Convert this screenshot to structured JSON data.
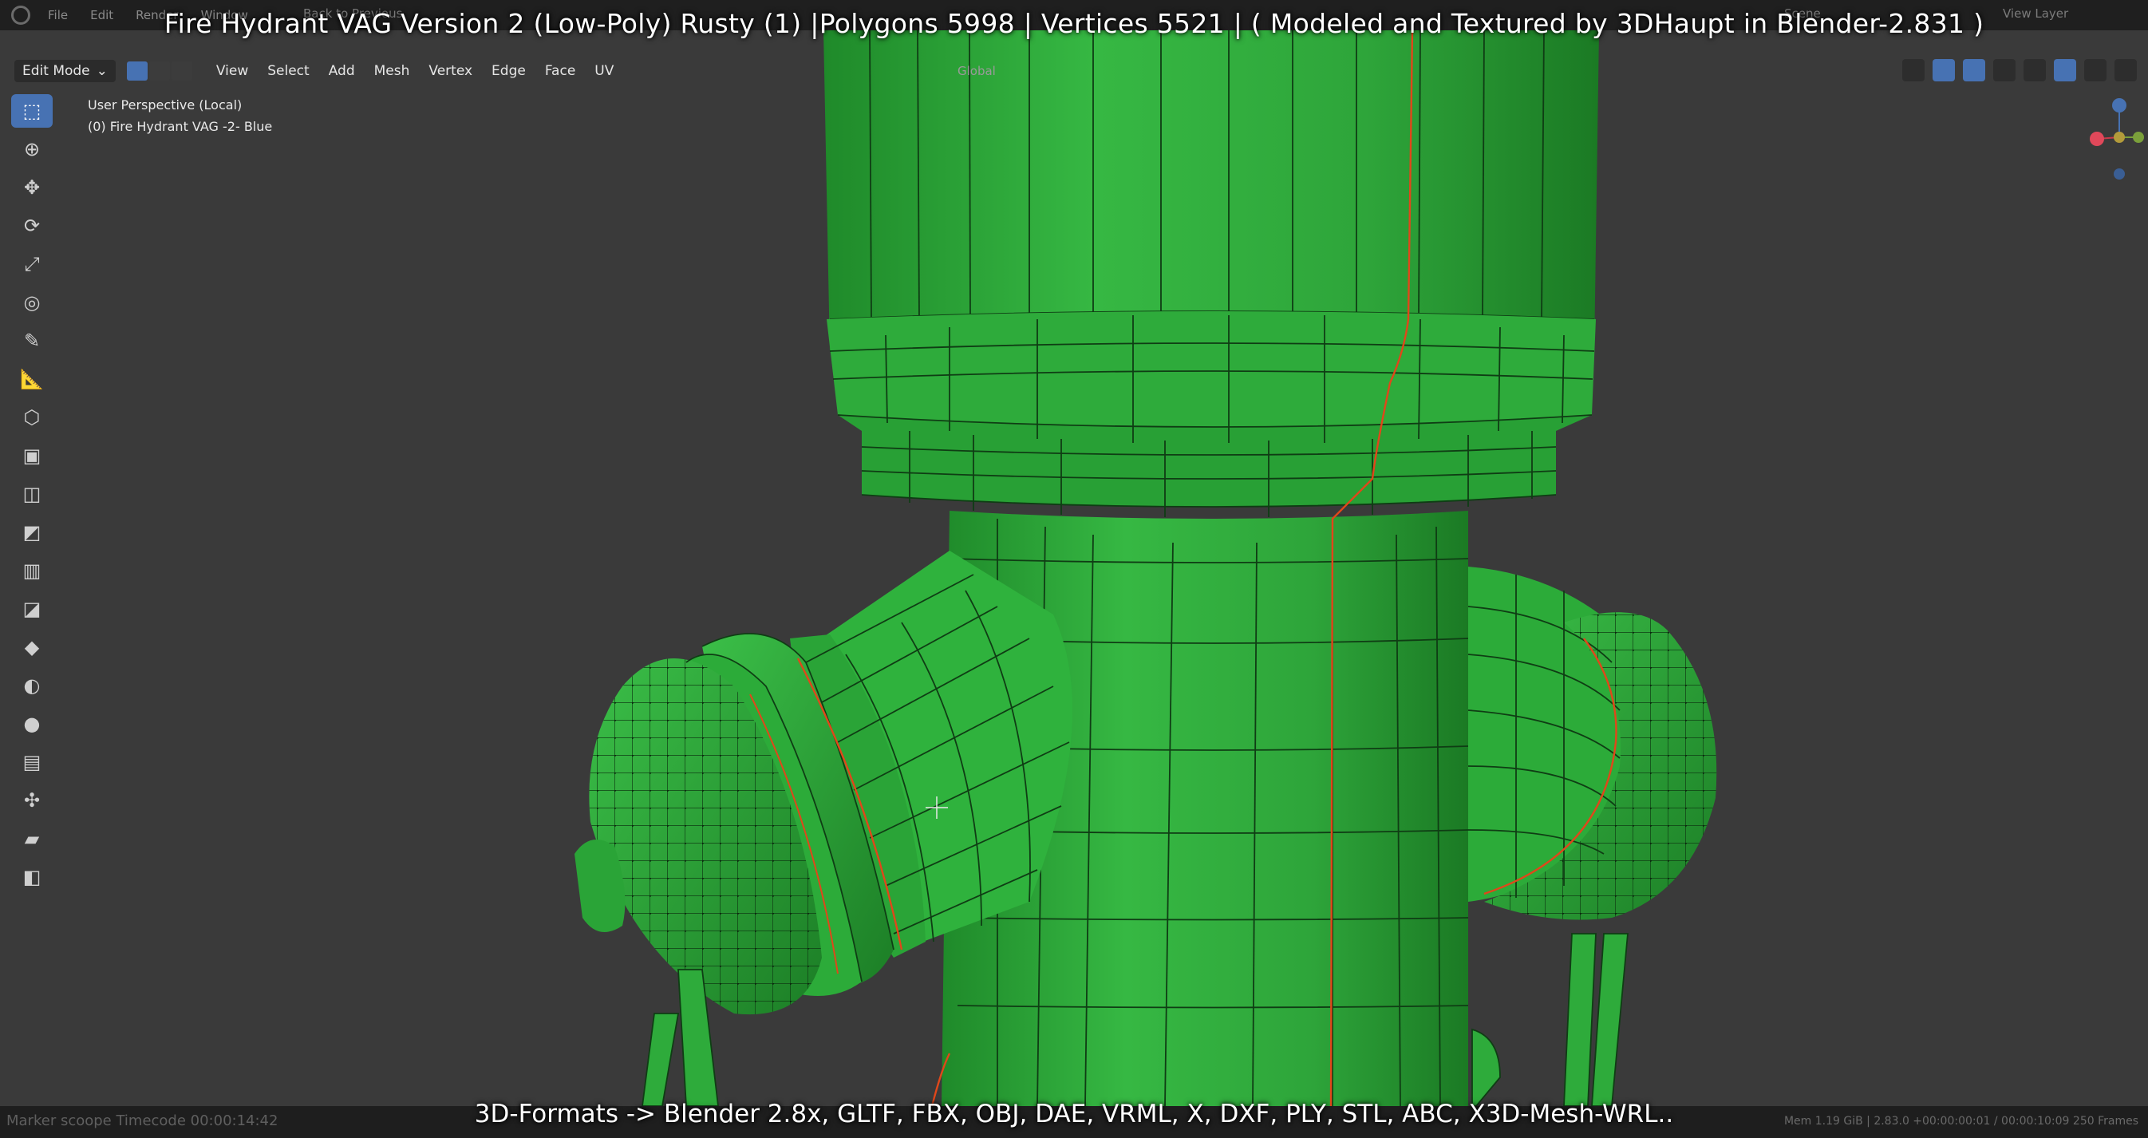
{
  "topbar": {
    "menus": [
      "File",
      "Edit",
      "Render",
      "Window"
    ],
    "workspace": "Back to Previous",
    "scene": "Scene",
    "view_layer": "View Layer"
  },
  "overlay": {
    "title": "Fire Hydrant VAG Version 2 (Low-Poly) Rusty (1) |Polygons 5998 | Vertices 5521 | ( Modeled and Textured by 3DHaupt in Blender-2.831 )",
    "formats": "3D-Formats -> Blender 2.8x, GLTF, FBX, OBJ, DAE, VRML, X, DXF, PLY, STL, ABC, X3D-Mesh-WRL.."
  },
  "header": {
    "mode": "Edit Mode",
    "menus": [
      "View",
      "Select",
      "Add",
      "Mesh",
      "Vertex",
      "Edge",
      "Face",
      "UV"
    ],
    "orientation": "Global"
  },
  "viewport": {
    "perspective": "User Perspective (Local)",
    "object": "(0) Fire Hydrant VAG -2- Blue"
  },
  "toolbar": {
    "icons": [
      "select-box-icon",
      "cursor-icon",
      "move-icon",
      "rotate-icon",
      "scale-icon",
      "transform-icon",
      "annotate-icon",
      "measure-icon",
      "add-cube-icon",
      "extrude-icon",
      "inset-icon",
      "bevel-icon",
      "loop-cut-icon",
      "knife-icon",
      "poly-build-icon",
      "spin-icon",
      "smooth-icon",
      "edge-slide-icon",
      "shrink-icon",
      "shear-icon",
      "rip-icon"
    ]
  },
  "statusbar": {
    "left": "Marker  scoope     Timecode 00:00:14:42",
    "right": "Mem 1.19 GiB | 2.83.0   +00:00:00:01 / 00:00:10:09   250 Frames"
  },
  "colors": {
    "mesh_green": "#2fae3c",
    "seam_red": "#e0471a",
    "background": "#3a3a3a",
    "active_blue": "#4772b3"
  }
}
